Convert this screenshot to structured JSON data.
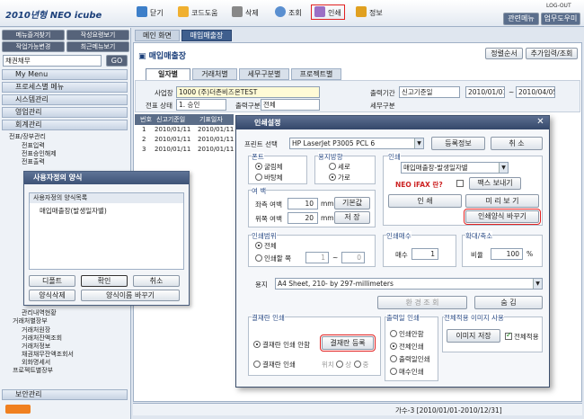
{
  "header": {
    "app_title": "2010년형 NEO icube",
    "logout": "LOG-OUT",
    "toolbar": [
      "닫기",
      "코드도움",
      "삭제",
      "조회",
      "인쇄",
      "정보"
    ],
    "right_buttons": [
      "관련메뉴",
      "업무도우미"
    ]
  },
  "side": {
    "buttons": [
      "메뉴즐겨찾기",
      "작성요령보기",
      "작업가능변경",
      "최근메뉴보기"
    ],
    "search_value": "채권채무",
    "go": "GO",
    "sections": [
      "My Menu",
      "프로세스별 메뉴",
      "시스템관리",
      "영업관리",
      "회계관리"
    ],
    "tree": [
      "전표/장부관리",
      "전표입력",
      "전표승인해제",
      "전표출력",
      "관리내역현황",
      "거래처별장부",
      "거래처원장",
      "거래처잔액조회",
      "거래처정보",
      "채권채무잔액조회서",
      "외화명세서",
      "프로젝트별장부"
    ],
    "bottom": "보안관리"
  },
  "tabs": {
    "main": "메인 화면",
    "active": "매입매출장"
  },
  "page": {
    "title": "매입매출장",
    "btn_sort": "정렬순서",
    "btn_add": "추가입력/조회",
    "subtabs": [
      "일자별",
      "거래처별",
      "세무구분별",
      "프로젝트별"
    ],
    "filters": {
      "site_label": "사업장",
      "site_value": "1000 (주)더존비즈온TEST",
      "slip_label": "전표 상태",
      "slip_value": "1. 승인",
      "print_kind_label": "출력구분",
      "print_kind_value": "전체",
      "period_label": "출력기간",
      "period_type": "신고기준일",
      "date_from": "2010/01/01",
      "date_to": "2010/04/05",
      "tax_label": "세무구분"
    },
    "columns": [
      "번호",
      "신고기준일",
      "기표일자"
    ],
    "rows": [
      [
        "1",
        "2010/01/11",
        "2010/01/11"
      ],
      [
        "2",
        "2010/01/11",
        "2010/01/11"
      ],
      [
        "3",
        "2010/01/11",
        "2010/01/11"
      ]
    ],
    "status": "가수-3 [2010/01/01-2010/12/31]"
  },
  "print_dialog": {
    "title": "인쇄설정",
    "printer_label": "프린트 선택",
    "printer_value": "HP LaserJet P3005 PCL 6",
    "btn_register": "등록정보",
    "btn_cancel": "취 소",
    "font_title": "폰트",
    "font_opts": [
      "굴림체",
      "바탕체"
    ],
    "orient_title": "용지방향",
    "orient_opts": [
      "세로",
      "가로"
    ],
    "print_title": "인쇄",
    "print_select": "매입매출장-발생일자별",
    "fax_label": "NEO iFAX 란?",
    "fax_btn": "팩스 보내기",
    "btn_print": "인 쇄",
    "btn_preview": "미 리 보 기",
    "btn_change_form": "인쇄양식 바꾸기",
    "margin_title": "여 백",
    "left_margin": "좌측 여백",
    "left_value": "10",
    "top_margin": "위쪽 여백",
    "top_value": "20",
    "mm": "mm",
    "btn_default": "기본값",
    "btn_save": "저 장",
    "range_title": "인쇄범위",
    "range_all": "전체",
    "range_part": "인쇄할 쪽",
    "from": "1",
    "tilde": "~",
    "to": "0",
    "copies_title": "인쇄매수",
    "copies_label": "매수",
    "copies_value": "1",
    "zoom_title": "확대/축소",
    "zoom_label": "비율",
    "zoom_value": "100",
    "pct": "%",
    "paper_label": "용지",
    "paper_value": "A4 Sheet, 210- by 297-millimeters",
    "btn_env": "환 경 조 회",
    "btn_close": "숨 김",
    "sign_title": "결재란 인쇄",
    "sign_opt1": "결재란 인쇄 안함",
    "sign_register": "결재란 등록",
    "sign_opt2": "결재란 인쇄 ",
    "sign_pos": "위치",
    "sign_top": "상",
    "sign_bottom": "중",
    "out_title": "출력일 인쇄",
    "out_opts": [
      "인쇄안함",
      "전체인쇄",
      "출력일인쇄",
      "매수인쇄"
    ],
    "img_title": "전체적용 이미지 사용",
    "img_btn": "이미지 저장",
    "img_chk": "전체적용"
  },
  "form_dialog": {
    "title": "사용자정의 양식",
    "list_header": "사용자정의 양식목록",
    "item": "매입매출장(발생일자별)",
    "buttons": [
      "디폴트",
      "확인",
      "취소",
      "양식삭제",
      "양식이름 바꾸기"
    ]
  }
}
